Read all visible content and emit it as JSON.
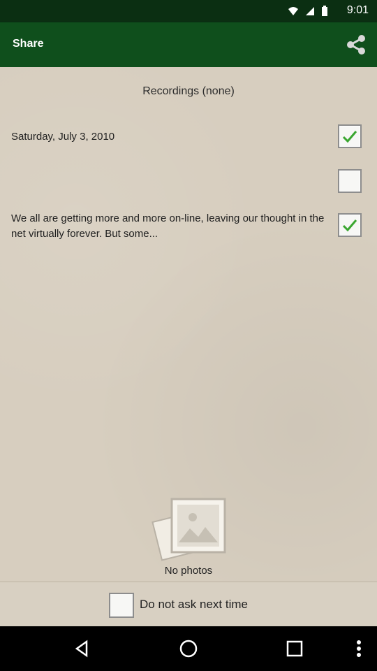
{
  "status": {
    "time": "9:01"
  },
  "appbar": {
    "title": "Share",
    "share_icon": "share-icon"
  },
  "recordings": {
    "header": "Recordings (none)"
  },
  "items": [
    {
      "label": "Saturday, July 3, 2010",
      "checked": true
    },
    {
      "label": "",
      "checked": false
    },
    {
      "label": "We all are getting more and more on-line, leaving our thought in the net virtually forever. But some...",
      "checked": true
    }
  ],
  "photos": {
    "empty_label": "No photos"
  },
  "bottom": {
    "do_not_ask_label": "Do not ask next time",
    "checked": false
  },
  "colors": {
    "appbar": "#0f4f1c",
    "statusbar": "#0b2f12",
    "check": "#3aa62f"
  }
}
